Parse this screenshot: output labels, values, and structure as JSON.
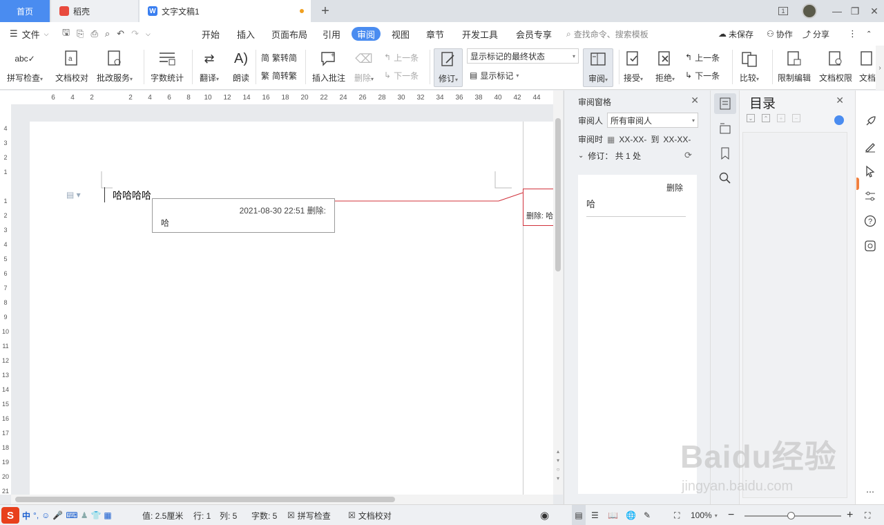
{
  "tabs": {
    "home": "首页",
    "daoke": "稻壳",
    "doc": "文字文稿1"
  },
  "menu": {
    "file": "文件",
    "items": [
      "开始",
      "插入",
      "页面布局",
      "引用",
      "审阅",
      "视图",
      "章节",
      "开发工具",
      "会员专享"
    ],
    "active": "审阅",
    "search_placeholder": "查找命令、搜索模板",
    "unsaved": "未保存",
    "collab": "协作",
    "share": "分享"
  },
  "ribbon": {
    "spell_check": "拼写检查",
    "doc_check": "文档校对",
    "review_service": "批改服务",
    "word_count": "字数统计",
    "translate": "翻译",
    "read_aloud": "朗读",
    "trad_simp": "繁转简",
    "simp_trad": "简转繁",
    "insert_comment": "插入批注",
    "delete": "删除",
    "prev": "上一条",
    "next": "下一条",
    "track_changes": "修订",
    "markup_state": "显示标记的最终状态",
    "show_markup": "显示标记",
    "review": "审阅",
    "accept": "接受",
    "reject": "拒绝",
    "prev2": "上一条",
    "next2": "下一条",
    "compare": "比较",
    "restrict_edit": "限制编辑",
    "doc_permission": "文档权限",
    "doc_more": "文档"
  },
  "document": {
    "text": "哈哈哈哈",
    "comment_head": "2021-08-30 22:51 删除:",
    "comment_body": "哈",
    "markup_balloon": "删除: 哈"
  },
  "review_pane": {
    "title": "审阅窗格",
    "reviewer_label": "审阅人",
    "reviewer_value": "所有审阅人",
    "time_label": "审阅时",
    "time_from": "XX-XX-",
    "to": "到",
    "time_to": "XX-XX-",
    "revisions": "修订：  共 1 处",
    "card_kind": "删除",
    "card_content": "哈"
  },
  "toc": {
    "title": "目录"
  },
  "statusbar": {
    "setting": "值: 2.5厘米",
    "row": "行: 1",
    "col": "列: 5",
    "words": "字数: 5",
    "spell": "拼写检查",
    "proof": "文档校对",
    "zoom": "100%",
    "zoom_fraction": 0.48
  },
  "watermark": {
    "big": "Baidu经验",
    "small": "jingyan.baidu.com"
  },
  "colors": {
    "accent": "#4a8cf0",
    "revision": "#d0303a",
    "unsaved_dot": "#f0a020"
  }
}
